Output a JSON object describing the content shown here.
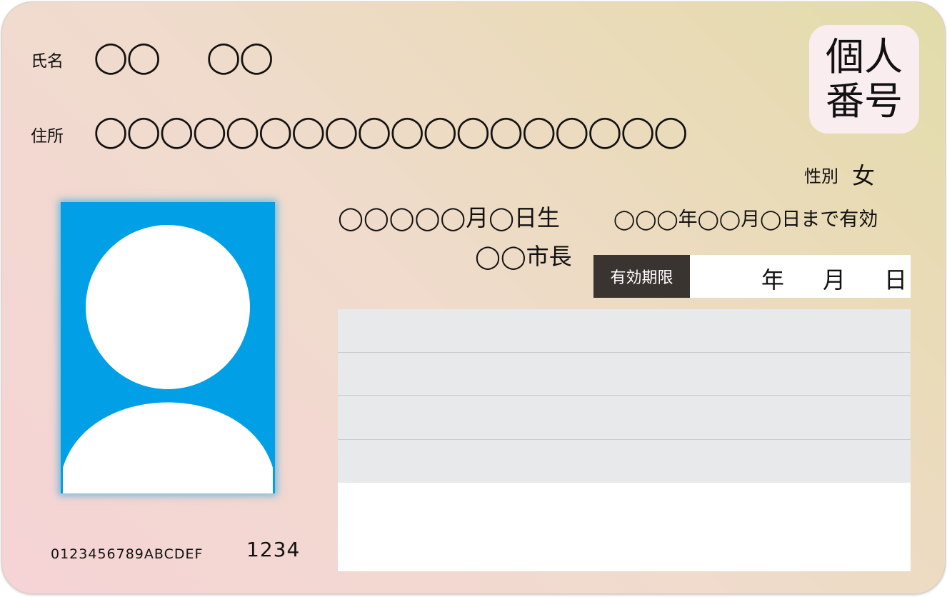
{
  "card": {
    "name_label": "氏名",
    "name_family": "◯◯",
    "name_given": "◯◯",
    "address_label": "住所",
    "address_value": "◯◯◯◯◯◯◯◯◯◯◯◯◯◯◯◯◯◯",
    "stamp": {
      "line1": "個人",
      "line2": "番号"
    },
    "sex_label": "性別",
    "sex_value": "女",
    "birthdate": "◯◯◯◯◯月◯日生",
    "validity": "◯◯◯年◯◯月◯日まで有効",
    "issuer": "◯◯市長",
    "expiry_label": "有効期限",
    "expiry_year": "年",
    "expiry_month": "月",
    "expiry_day": "日",
    "serial": "0123456789ABCDEF",
    "code": "1234"
  },
  "colors": {
    "photo_bg": "#009fe6",
    "label_bg": "#3a3431",
    "stamp_bg": "#faedef",
    "field_gray": "#e8e9eb"
  },
  "icons": {
    "photo": "person-silhouette-icon"
  }
}
